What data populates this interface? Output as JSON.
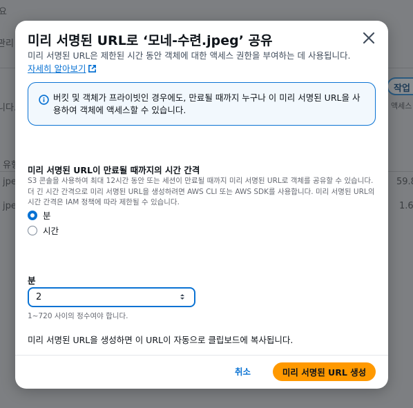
{
  "background": {
    "fragments": [
      "요",
      "관리",
      "니다.",
      "유형",
      "jpeg",
      "jpeg",
      "작업",
      "액세스",
      "59.8",
      "1.6"
    ]
  },
  "modal": {
    "title": "미리 서명된 URL로 ‘모네-수련.jpeg’ 공유",
    "description": "미리 서명된 URL은 제한된 시간 동안 객체에 대한 액세스 권한을 부여하는 데 사용됩니다.",
    "learn_more_link": "자세히 알아보기",
    "info_message": "버킷 및 객체가 프라이빗인 경우에도, 만료될 때까지 누구나 이 미리 서명된 URL을 사용하여 객체에 액세스할 수 있습니다.",
    "interval_section": {
      "label": "미리 서명된 URL이 만료될 때까지의 시간 간격",
      "description": "S3 콘솔을 사용하여 최대 12시간 동안 또는 세션이 만료될 때까지 미리 서명된 URL로 객체를 공유할 수 있습니다. 더 긴 시간 간격으로 미리 서명된 URL을 생성하려면 AWS CLI 또는 AWS SDK를 사용합니다. 미리 서명된 URL의 시간 간격은 IAM 정책에 따라 제한될 수 있습니다.",
      "options": [
        {
          "label": "분",
          "selected": true
        },
        {
          "label": "시간",
          "selected": false
        }
      ]
    },
    "minutes_field": {
      "label": "분",
      "value": "2",
      "hint": "1~720 사이의 정수여야 합니다."
    },
    "footer_note": "미리 서명된 URL을 생성하면 이 URL이 자동으로 클립보드에 복사됩니다.",
    "cancel_label": "취소",
    "submit_label": "미리 서명된 URL 생성"
  },
  "colors": {
    "accent": "#0972d3",
    "primary_button": "#ff9900",
    "overlay": "#7d7f82"
  },
  "icons": {
    "close": "close-icon",
    "external_link": "external-link-icon",
    "info": "info-icon",
    "spinner": "number-spinner-icon"
  }
}
